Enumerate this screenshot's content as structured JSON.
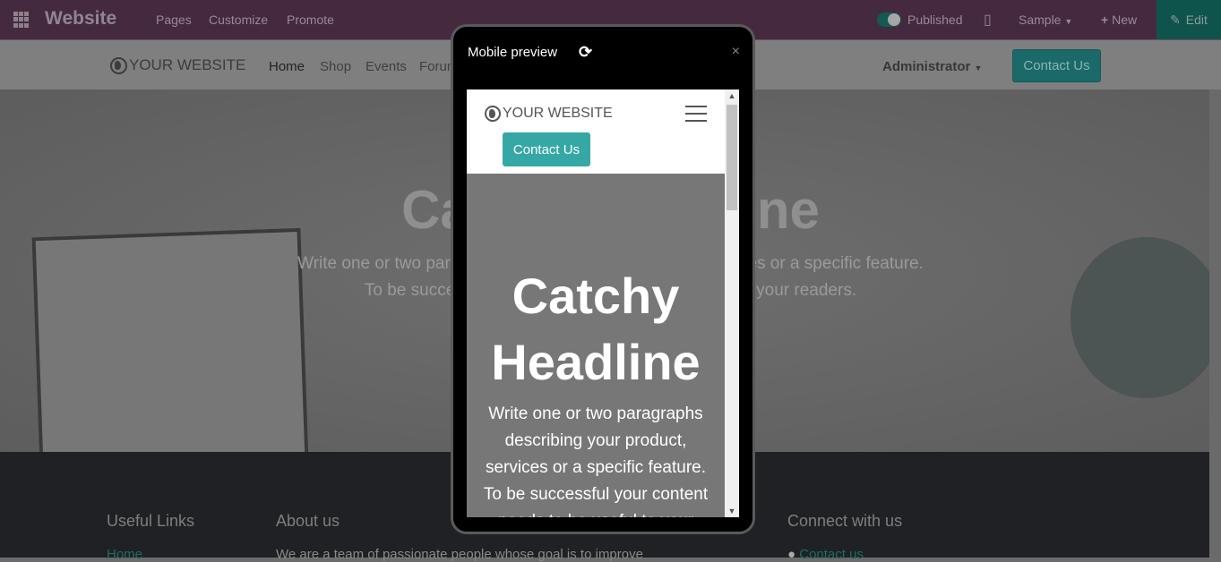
{
  "topbar": {
    "app": "Website",
    "nav": [
      "Pages",
      "Customize",
      "Promote"
    ],
    "published": "Published",
    "published_on": true,
    "sample": "Sample",
    "new": "New",
    "edit": "Edit"
  },
  "header": {
    "logo": "YOUR WEBSITE",
    "nav": [
      "Home",
      "Shop",
      "Events",
      "Forum"
    ],
    "admin": "Administrator",
    "contact": "Contact Us"
  },
  "hero": {
    "title": "Catchy Headline",
    "line1": "Write one or two paragraphs describing your product, services or a specific feature.",
    "line2": "To be successful your content needs to be useful to your readers."
  },
  "footer": {
    "useful_links": "Useful Links",
    "home": "Home",
    "about": "About us",
    "about_text": "We are a team of passionate people whose goal is to improve",
    "connect": "Connect with us",
    "contact_us": "Contact us"
  },
  "modal": {
    "title": "Mobile preview",
    "close": "×",
    "logo": "YOUR WEBSITE",
    "contact": "Contact Us",
    "headline": "Catchy Headline",
    "text": "Write one or two paragraphs describing your product, services or a specific feature. To be successful your content needs to be useful to your readers."
  },
  "colors": {
    "topbar": "#45293f",
    "accent": "#35a8a6"
  }
}
